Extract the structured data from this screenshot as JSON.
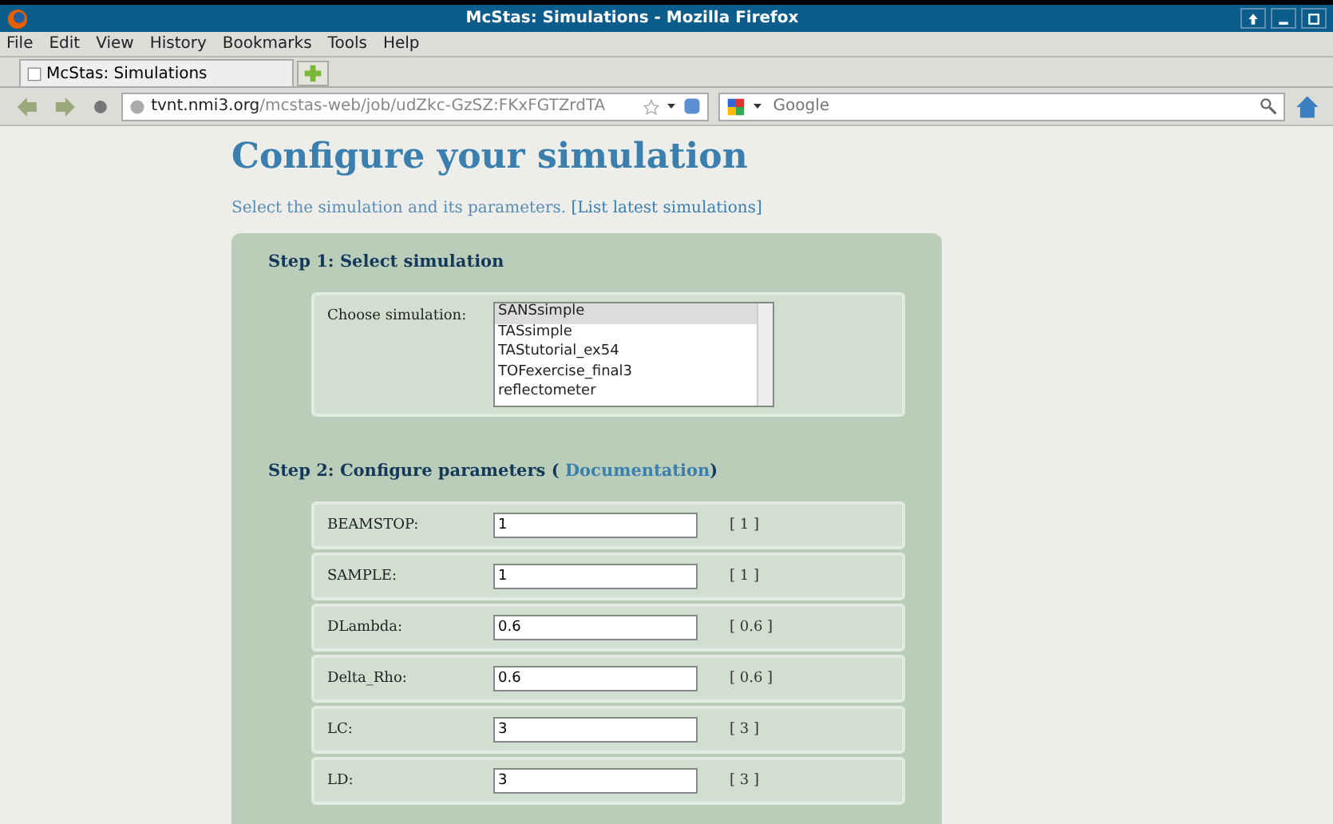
{
  "window": {
    "title": "McStas: Simulations - Mozilla Firefox"
  },
  "menu": [
    "File",
    "Edit",
    "View",
    "History",
    "Bookmarks",
    "Tools",
    "Help"
  ],
  "tabs": [
    {
      "label": "McStas: Simulations",
      "selected": true
    }
  ],
  "address": {
    "host": "tvnt.nmi3.org",
    "path": "/mcstas-web/job/udZkc-GzSZ:FKxFGTZrdTA"
  },
  "search": {
    "placeholder": "Google"
  },
  "page": {
    "heading": "Configure your simulation",
    "intro": "Select the simulation and its parameters.",
    "intro_link": "[List latest simulations]",
    "step1": {
      "title": "Step 1: Select simulation",
      "label": "Choose simulation:",
      "options": [
        {
          "label": "SANSsimple",
          "selected": true
        },
        {
          "label": "TASsimple",
          "selected": false
        },
        {
          "label": "TAStutorial_ex54",
          "selected": false
        },
        {
          "label": "TOFexercise_final3",
          "selected": false
        },
        {
          "label": "reflectometer",
          "selected": false
        }
      ]
    },
    "step2": {
      "title": "Step 2: Configure parameters (",
      "link": "Documentation",
      "title_end": ")",
      "params": [
        {
          "name": "BEAMSTOP:",
          "value": "1",
          "default": "[ 1 ]"
        },
        {
          "name": "SAMPLE:",
          "value": "1",
          "default": "[ 1 ]"
        },
        {
          "name": "DLambda:",
          "value": "0.6",
          "default": "[ 0.6 ]"
        },
        {
          "name": "Delta_Rho:",
          "value": "0.6",
          "default": "[ 0.6 ]"
        },
        {
          "name": "LC:",
          "value": "3",
          "default": "[ 3 ]"
        },
        {
          "name": "LD:",
          "value": "3",
          "default": "[ 3 ]"
        }
      ]
    }
  }
}
